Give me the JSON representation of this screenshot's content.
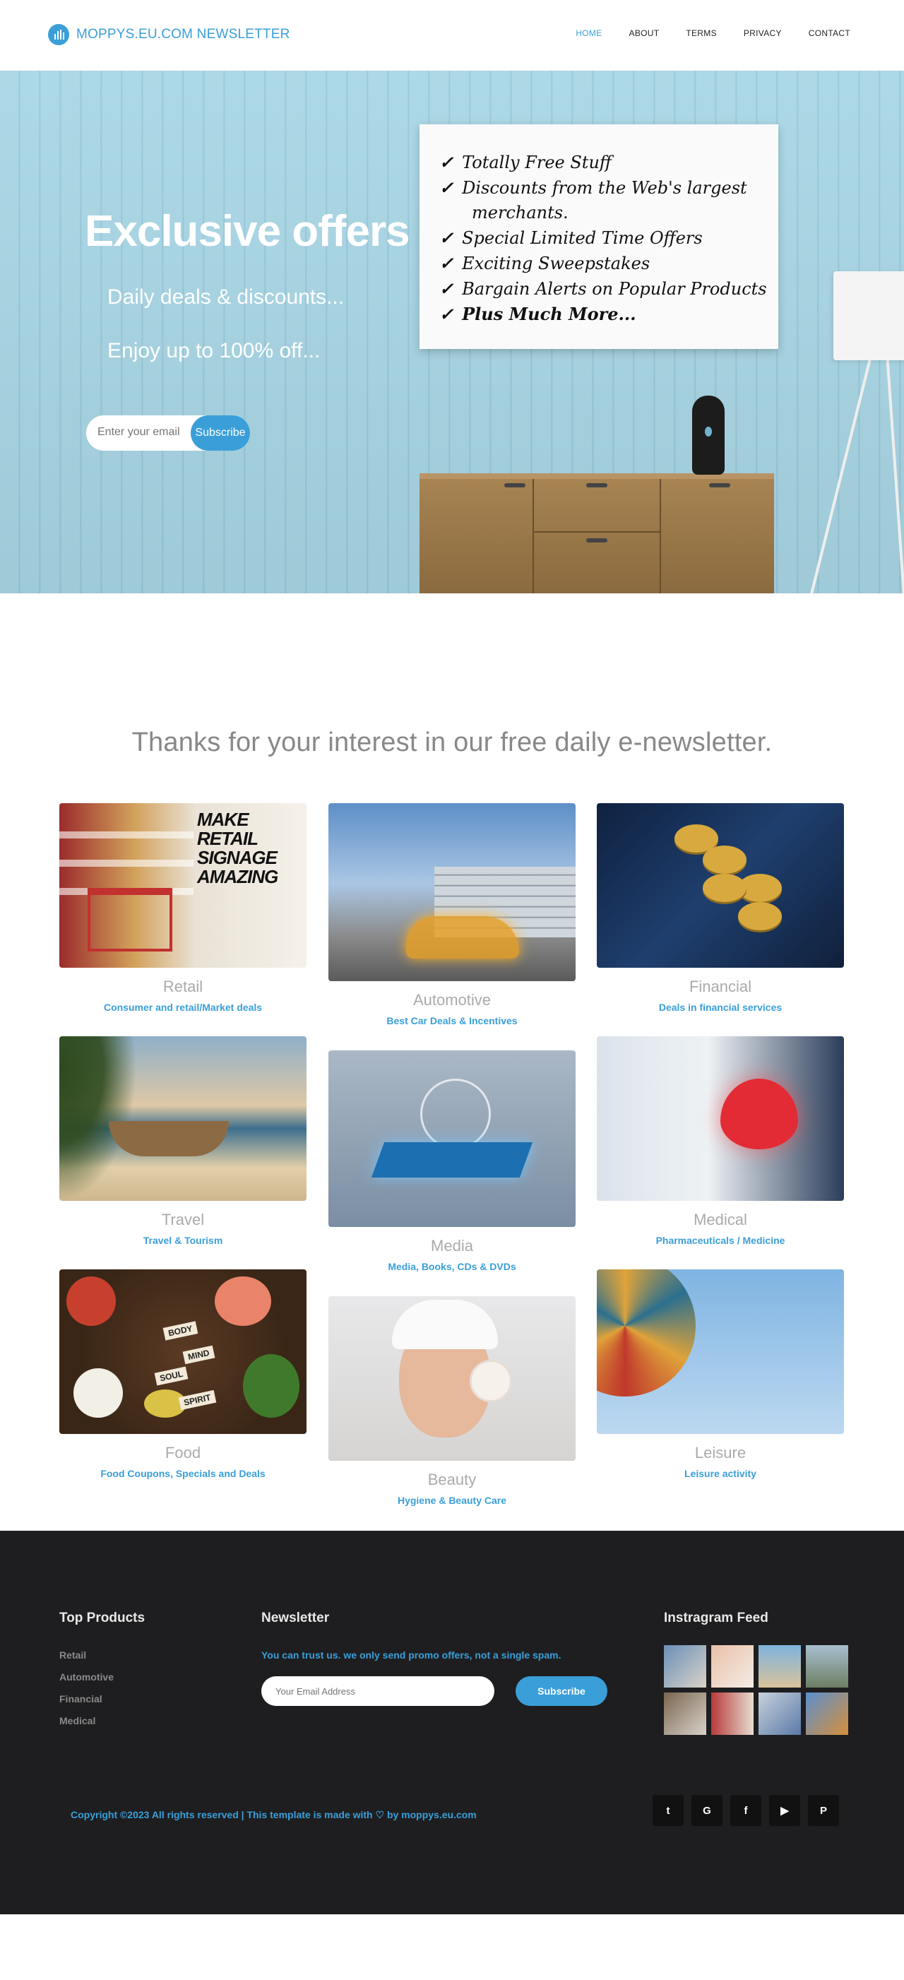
{
  "brand": {
    "name": "MOPPYS.EU.COM  NEWSLETTER"
  },
  "nav": {
    "items": [
      "HOME",
      "ABOUT",
      "TERMS",
      "PRIVACY",
      "CONTACT"
    ],
    "active": "HOME"
  },
  "hero": {
    "title": "Exclusive offers",
    "subtitle1": "Daily deals & discounts...",
    "subtitle2": "Enjoy up to 100% off...",
    "email_placeholder": "Enter your email",
    "subscribe_label": "Subscribe",
    "board": [
      "Totally Free Stuff",
      "Discounts from the Web's largest",
      "merchants.",
      "Special Limited Time Offers",
      "Exciting Sweepstakes",
      "Bargain Alerts on Popular Products",
      "Plus Much More..."
    ],
    "board_check": "✓"
  },
  "intro": {
    "text": "Thanks for your interest in our free daily e-newsletter."
  },
  "categories": [
    {
      "title": "Retail",
      "subtitle": "Consumer and retail/Market deals",
      "image_text": "MAKE RETAIL SIGNAGE AMAZING"
    },
    {
      "title": "Automotive",
      "subtitle": "Best Car Deals & Incentives"
    },
    {
      "title": "Financial",
      "subtitle": "Deals in financial services"
    },
    {
      "title": "Travel",
      "subtitle": "Travel & Tourism"
    },
    {
      "title": "Media",
      "subtitle": "Media, Books, CDs & DVDs"
    },
    {
      "title": "Medical",
      "subtitle": "Pharmaceuticals / Medicine"
    },
    {
      "title": "Food",
      "subtitle": "Food Coupons, Specials and Deals",
      "image_tags": [
        "BODY",
        "MIND",
        "SOUL",
        "SPIRIT"
      ]
    },
    {
      "title": "Beauty",
      "subtitle": "Hygiene & Beauty Care"
    },
    {
      "title": "Leisure",
      "subtitle": "Leisure activity"
    }
  ],
  "footer": {
    "top_products": {
      "title": "Top Products",
      "links": [
        "Retail",
        "Automotive",
        "Financial",
        "Medical"
      ]
    },
    "newsletter": {
      "title": "Newsletter",
      "note": "You can trust us. we only send promo offers, not a single spam.",
      "email_placeholder": "Your Email Address",
      "subscribe_label": "Subscribe"
    },
    "instagram": {
      "title": "Instragram Feed"
    },
    "copyright": "Copyright ©2023 All rights reserved | This template is made with ♡ by moppys.eu.com",
    "socials": [
      {
        "icon": "twitter-icon",
        "glyph": "t"
      },
      {
        "icon": "google-icon",
        "glyph": "G"
      },
      {
        "icon": "facebook-icon",
        "glyph": "f"
      },
      {
        "icon": "youtube-icon",
        "glyph": "▶"
      },
      {
        "icon": "pinterest-icon",
        "glyph": "P"
      }
    ]
  },
  "colors": {
    "accent": "#3a9fd8",
    "footer_bg": "#1e1e20",
    "category_title": "#aaaaaa"
  }
}
